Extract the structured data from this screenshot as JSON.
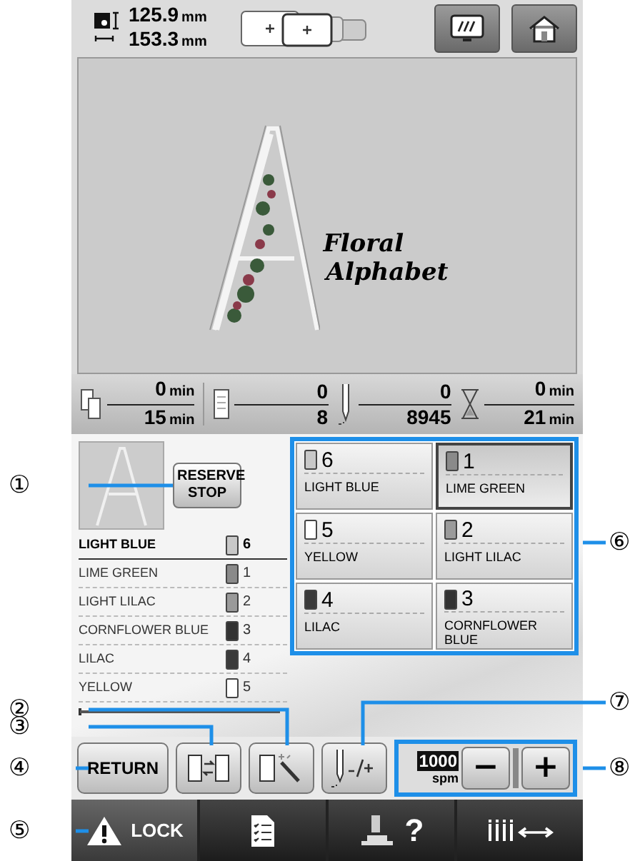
{
  "size": [
    {
      "value": "125.9",
      "unit": "mm"
    },
    {
      "value": "153.3",
      "unit": "mm"
    }
  ],
  "design": {
    "text_lines": [
      "Floral",
      "Alphabet"
    ]
  },
  "stats": [
    {
      "kind": "time",
      "current": "0",
      "current_unit": "min",
      "total": "15",
      "total_unit": "min"
    },
    {
      "kind": "colors",
      "current": "0",
      "total": "8"
    },
    {
      "kind": "stitches",
      "current": "0",
      "total": "8945"
    },
    {
      "kind": "remaining",
      "current": "0",
      "current_unit": "min",
      "total": "21",
      "total_unit": "min"
    }
  ],
  "reserve_stop": "RESERVE STOP",
  "color_list": [
    {
      "name": "LIGHT BLUE",
      "number": "6",
      "color": "#c8c8c8",
      "selected": true
    },
    {
      "name": "LIME GREEN",
      "number": "1",
      "color": "#8a8a8a",
      "selected": false
    },
    {
      "name": "LIGHT LILAC",
      "number": "2",
      "color": "#9a9a9a",
      "selected": false
    },
    {
      "name": "CORNFLOWER BLUE",
      "number": "3",
      "color": "#333333",
      "selected": false
    },
    {
      "name": "LILAC",
      "number": "4",
      "color": "#3a3a3a",
      "selected": false
    },
    {
      "name": "YELLOW",
      "number": "5",
      "color": "#ffffff",
      "selected": false
    }
  ],
  "thread_grid": [
    {
      "number": "6",
      "name": "LIGHT BLUE",
      "color": "#c8c8c8",
      "selected": false
    },
    {
      "number": "1",
      "name": "LIME GREEN",
      "color": "#8a8a8a",
      "selected": true
    },
    {
      "number": "5",
      "name": "YELLOW",
      "color": "#ffffff",
      "selected": false
    },
    {
      "number": "2",
      "name": "LIGHT LILAC",
      "color": "#9a9a9a",
      "selected": false
    },
    {
      "number": "4",
      "name": "LILAC",
      "color": "#3a3a3a",
      "selected": false
    },
    {
      "number": "3",
      "name": "CORNFLOWER BLUE",
      "color": "#333333",
      "selected": false
    }
  ],
  "return_button": "RETURN",
  "speed": {
    "value": "1000",
    "unit": "spm",
    "minus": "−",
    "plus": "+"
  },
  "lock_button": "LOCK",
  "help_mark": "?",
  "callouts_left": [
    "①",
    "②",
    "③",
    "④",
    "⑤"
  ],
  "callouts_right": [
    "⑥",
    "⑦",
    "⑧"
  ]
}
